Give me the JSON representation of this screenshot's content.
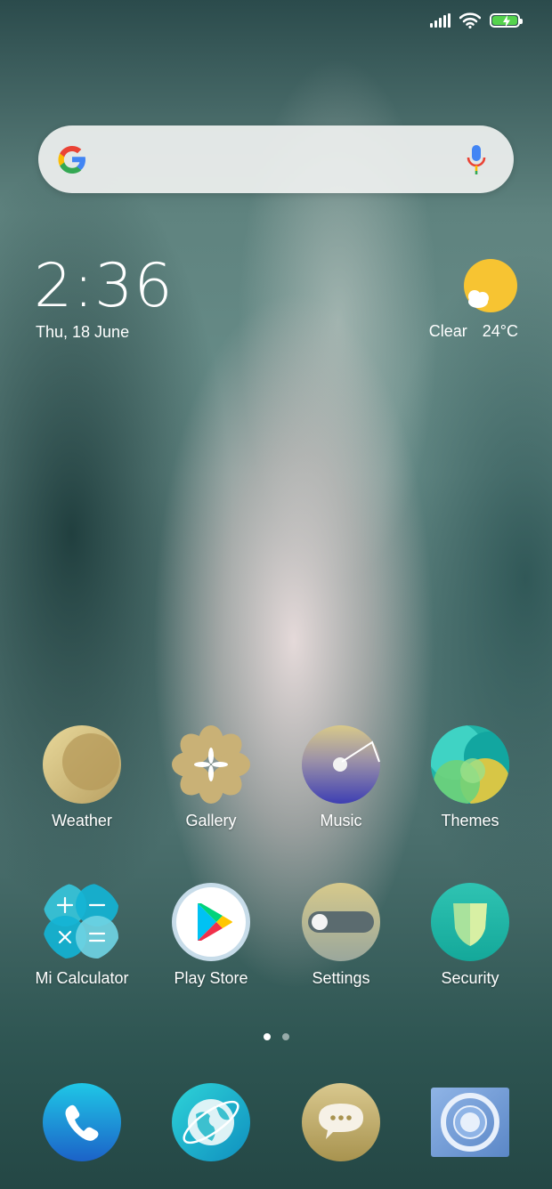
{
  "status_bar": {
    "signal_icon": "signal-icon",
    "wifi_icon": "wifi-icon",
    "battery_icon": "battery-charging-icon",
    "battery_color": "#55d24d"
  },
  "search_widget": {
    "logo_icon": "google-logo-icon",
    "voice_icon": "mic-icon"
  },
  "clock_widget": {
    "time": "2:36",
    "date": "Thu, 18 June"
  },
  "weather_widget": {
    "condition": "Clear",
    "temperature": "24°C",
    "icon": "sun-cloud-icon"
  },
  "apps": {
    "weather": {
      "label": "Weather",
      "icon": "moon-icon"
    },
    "gallery": {
      "label": "Gallery",
      "icon": "flower-icon"
    },
    "music": {
      "label": "Music",
      "icon": "record-icon"
    },
    "themes": {
      "label": "Themes",
      "icon": "themes-icon"
    },
    "calculator": {
      "label": "Mi Calculator",
      "icon": "calculator-icon"
    },
    "play_store": {
      "label": "Play Store",
      "icon": "play-store-icon"
    },
    "settings": {
      "label": "Settings",
      "icon": "toggle-icon"
    },
    "security": {
      "label": "Security",
      "icon": "shield-icon"
    }
  },
  "pager": {
    "pages": 2,
    "current": 1
  },
  "dock": {
    "phone": {
      "icon": "phone-icon"
    },
    "browser": {
      "icon": "browser-icon"
    },
    "messages": {
      "icon": "messages-icon"
    },
    "camera": {
      "icon": "camera-icon"
    }
  }
}
